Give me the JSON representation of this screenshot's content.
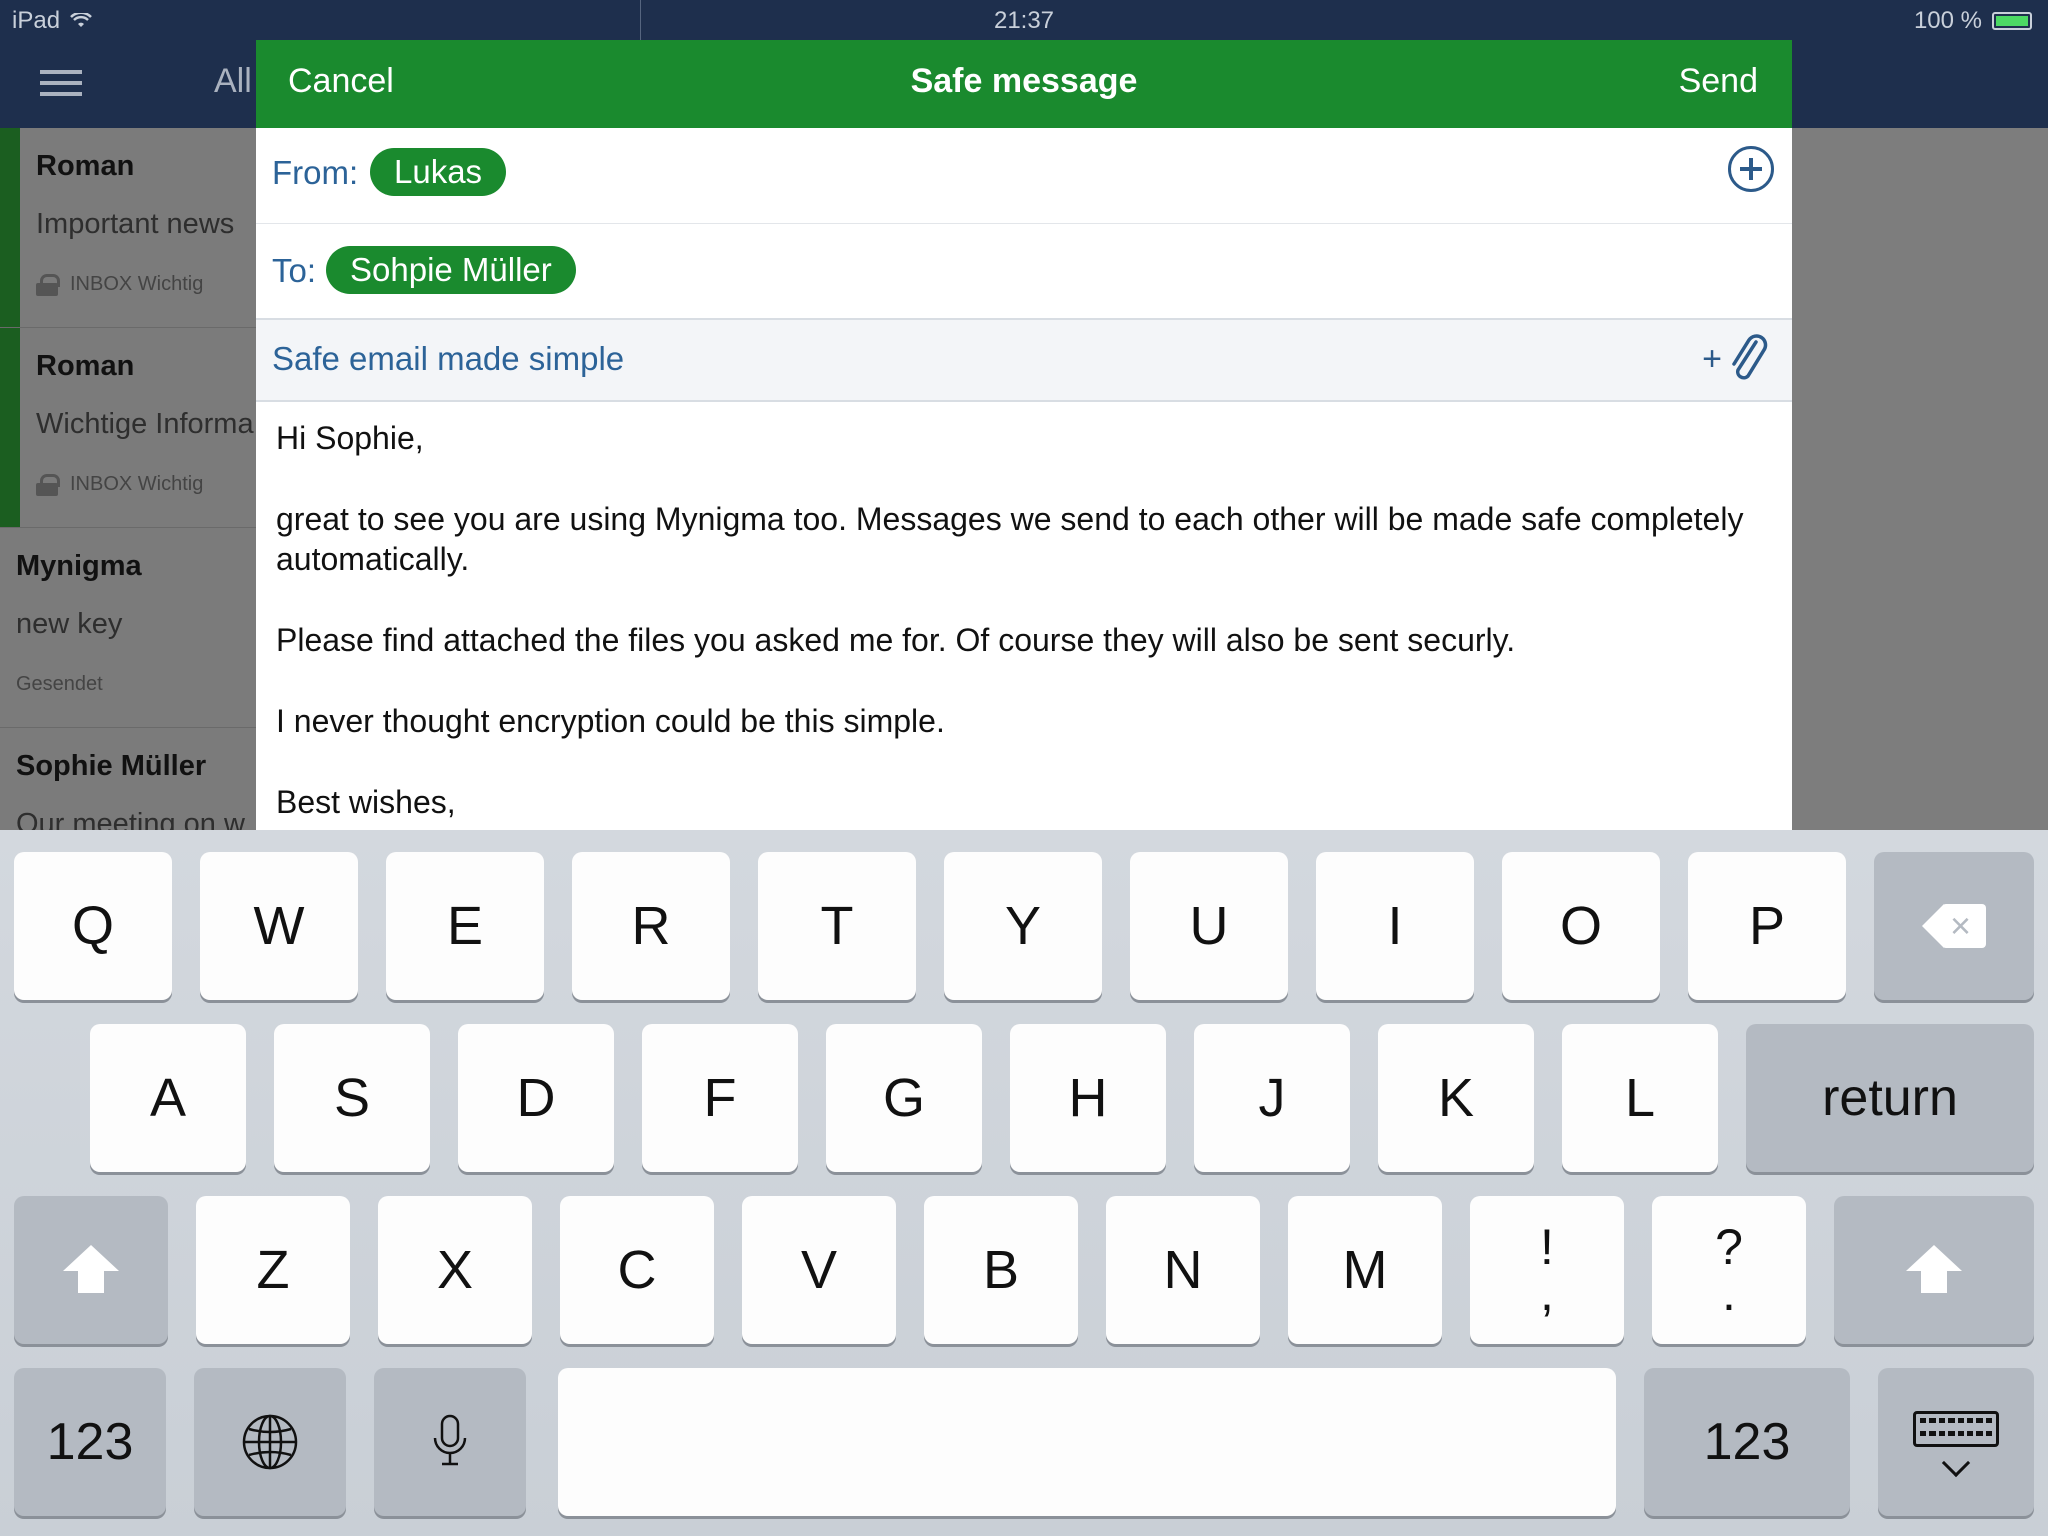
{
  "status_bar": {
    "device": "iPad",
    "time": "21:37",
    "battery": "100 %"
  },
  "background": {
    "nav_label": "All",
    "mail_items": [
      {
        "sender": "Roman",
        "subject": "Important news",
        "folder": "INBOX Wichtig"
      },
      {
        "sender": "Roman",
        "subject": "Wichtige Informa",
        "folder": "INBOX Wichtig"
      },
      {
        "sender": "Mynigma",
        "subject": "new key",
        "folder": "Gesendet"
      },
      {
        "sender": "Sophie Müller",
        "subject": "Our meeting on w"
      }
    ]
  },
  "compose": {
    "cancel_label": "Cancel",
    "title": "Safe message",
    "send_label": "Send",
    "from_label": "From:",
    "from_value": "Lukas",
    "to_label": "To:",
    "to_value": "Sohpie Müller",
    "subject": "Safe email made simple",
    "attach_plus": "+",
    "body": [
      "Hi Sophie,",
      "great to see you are using Mynigma too. Messages we send to each other will be made safe completely automatically.",
      "Please find attached the files you asked me for. Of course they will also be sent securly.",
      "I never thought encryption could be this simple.",
      "Best wishes,"
    ]
  },
  "keyboard": {
    "row1": [
      "Q",
      "W",
      "E",
      "R",
      "T",
      "Y",
      "U",
      "I",
      "O",
      "P"
    ],
    "row2": [
      "A",
      "S",
      "D",
      "F",
      "G",
      "H",
      "J",
      "K",
      "L"
    ],
    "return_label": "return",
    "row3": [
      "Z",
      "X",
      "C",
      "V",
      "B",
      "N",
      "M"
    ],
    "punct_excl": {
      "top": "!",
      "bottom": ","
    },
    "punct_q": {
      "top": "?",
      "bottom": "."
    },
    "num_label": "123",
    "num_label_right": "123"
  },
  "colors": {
    "header_green": "#1a8a2e",
    "nav_navy": "#1e2f4d",
    "field_blue": "#2c6398"
  }
}
